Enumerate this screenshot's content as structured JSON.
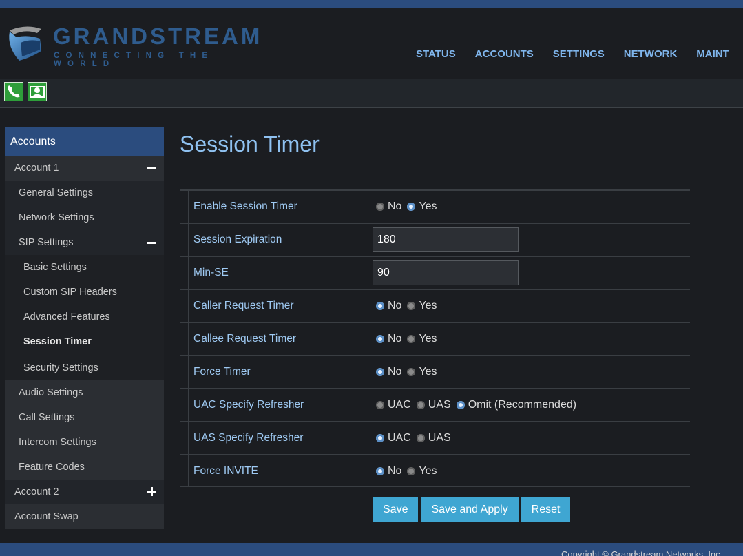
{
  "brand": {
    "name": "GRANDSTREAM",
    "tagline": "CONNECTING THE WORLD"
  },
  "topnav": [
    "STATUS",
    "ACCOUNTS",
    "SETTINGS",
    "NETWORK",
    "MAINT"
  ],
  "toolbar": {
    "icons": [
      "phone-icon",
      "contact-icon"
    ]
  },
  "sidebar": {
    "header": "Accounts",
    "account1": "Account 1",
    "general": "General Settings",
    "network": "Network Settings",
    "sip": "SIP Settings",
    "basic": "Basic Settings",
    "custom": "Custom SIP Headers",
    "advanced": "Advanced Features",
    "session": "Session Timer",
    "security": "Security Settings",
    "audio": "Audio Settings",
    "call": "Call Settings",
    "intercom": "Intercom Settings",
    "feature": "Feature Codes",
    "account2": "Account 2",
    "swap": "Account Swap"
  },
  "page": {
    "title": "Session Timer"
  },
  "form": {
    "enable_session_timer": {
      "label": "Enable Session Timer",
      "opt_no": "No",
      "opt_yes": "Yes",
      "selected": "Yes"
    },
    "session_expiration": {
      "label": "Session Expiration",
      "value": "180"
    },
    "min_se": {
      "label": "Min-SE",
      "value": "90"
    },
    "caller_request_timer": {
      "label": "Caller Request Timer",
      "opt_no": "No",
      "opt_yes": "Yes",
      "selected": "No"
    },
    "callee_request_timer": {
      "label": "Callee Request Timer",
      "opt_no": "No",
      "opt_yes": "Yes",
      "selected": "No"
    },
    "force_timer": {
      "label": "Force Timer",
      "opt_no": "No",
      "opt_yes": "Yes",
      "selected": "No"
    },
    "uac_specify_refresher": {
      "label": "UAC Specify Refresher",
      "opt_uac": "UAC",
      "opt_uas": "UAS",
      "opt_omit": "Omit (Recommended)",
      "selected": "Omit (Recommended)"
    },
    "uas_specify_refresher": {
      "label": "UAS Specify Refresher",
      "opt_uac": "UAC",
      "opt_uas": "UAS",
      "selected": "UAC"
    },
    "force_invite": {
      "label": "Force INVITE",
      "opt_no": "No",
      "opt_yes": "Yes",
      "selected": "No"
    }
  },
  "buttons": {
    "save": "Save",
    "save_apply": "Save and Apply",
    "reset": "Reset"
  },
  "footer": {
    "copyright": "Copyright © Grandstream Networks, Inc."
  },
  "colors": {
    "accent": "#2b4c7e",
    "link": "#7fb5ec",
    "button": "#3fa6d2",
    "label": "#9fcaf3"
  }
}
